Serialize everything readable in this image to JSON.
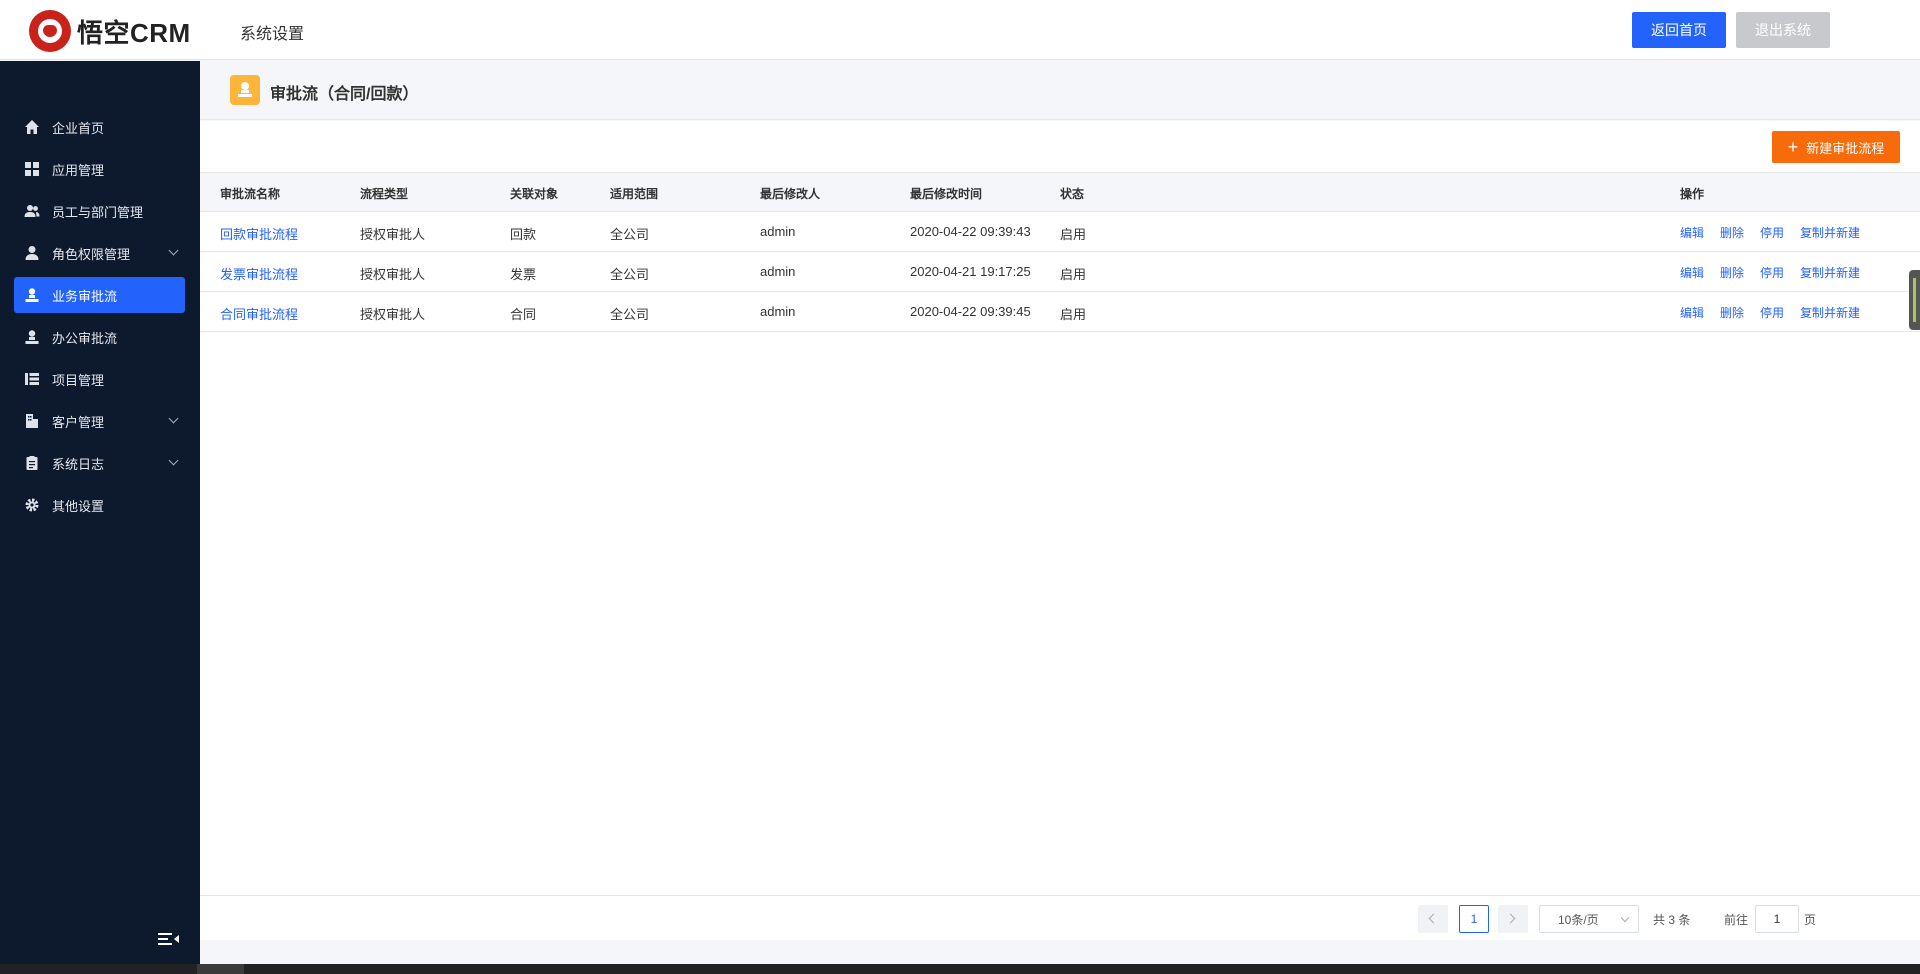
{
  "header": {
    "logo_text": "悟空CRM",
    "title": "系统设置",
    "home_button": "返回首页",
    "exit_button": "退出系统"
  },
  "sidebar": {
    "items": [
      {
        "label": "企业首页",
        "icon": "home-icon",
        "expandable": false,
        "active": false
      },
      {
        "label": "应用管理",
        "icon": "grid-icon",
        "expandable": false,
        "active": false
      },
      {
        "label": "员工与部门管理",
        "icon": "users-icon",
        "expandable": false,
        "active": false
      },
      {
        "label": "角色权限管理",
        "icon": "user-icon",
        "expandable": true,
        "active": false
      },
      {
        "label": "业务审批流",
        "icon": "approval-icon",
        "expandable": false,
        "active": true
      },
      {
        "label": "办公审批流",
        "icon": "approval-icon",
        "expandable": false,
        "active": false
      },
      {
        "label": "项目管理",
        "icon": "list-icon",
        "expandable": false,
        "active": false
      },
      {
        "label": "客户管理",
        "icon": "building-icon",
        "expandable": true,
        "active": false
      },
      {
        "label": "系统日志",
        "icon": "clipboard-icon",
        "expandable": true,
        "active": false
      },
      {
        "label": "其他设置",
        "icon": "gear-icon",
        "expandable": false,
        "active": false
      }
    ]
  },
  "page": {
    "title": "审批流（合同/回款）",
    "new_button": "新建审批流程"
  },
  "table": {
    "columns": [
      "审批流名称",
      "流程类型",
      "关联对象",
      "适用范围",
      "最后修改人",
      "最后修改时间",
      "状态",
      "操作"
    ],
    "rows": [
      {
        "name": "回款审批流程",
        "type": "授权审批人",
        "object": "回款",
        "scope": "全公司",
        "modifier": "admin",
        "time": "2020-04-22 09:39:43",
        "status": "启用"
      },
      {
        "name": "发票审批流程",
        "type": "授权审批人",
        "object": "发票",
        "scope": "全公司",
        "modifier": "admin",
        "time": "2020-04-21 19:17:25",
        "status": "启用"
      },
      {
        "name": "合同审批流程",
        "type": "授权审批人",
        "object": "合同",
        "scope": "全公司",
        "modifier": "admin",
        "time": "2020-04-22 09:39:45",
        "status": "启用"
      }
    ],
    "actions": [
      "编辑",
      "删除",
      "停用",
      "复制并新建"
    ]
  },
  "pagination": {
    "current_page": "1",
    "page_size": "10条/页",
    "total": "共 3 条",
    "goto_label": "前往",
    "goto_value": "1",
    "page_suffix": "页"
  },
  "colors": {
    "primary": "#2362fb",
    "sidebar_bg": "#0d1a2e",
    "new_button": "#f86b0a",
    "header_icon": "#fdb53a"
  }
}
